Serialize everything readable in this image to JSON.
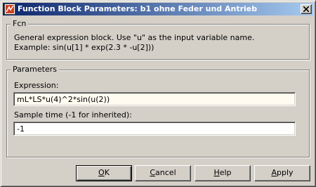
{
  "window": {
    "title": "Function Block Parameters: b1 ohne Feder und Antrieb"
  },
  "fcn_group": {
    "label": "Fcn",
    "description_line1": "General expression block. Use \"u\" as the input variable name.",
    "description_line2": "Example: sin(u[1] * exp(2.3 * -u[2]))"
  },
  "parameters_group": {
    "label": "Parameters",
    "expression_label": "Expression:",
    "expression_value": "mL*LS*u(4)^2*sin(u(2))",
    "sample_time_label": "Sample time (-1 for inherited):",
    "sample_time_value": "-1"
  },
  "buttons": {
    "ok": {
      "mnemonic": "O",
      "rest": "K"
    },
    "cancel": {
      "mnemonic": "C",
      "rest": "ancel"
    },
    "help": {
      "mnemonic": "H",
      "rest": "elp"
    },
    "apply": {
      "mnemonic": "A",
      "rest": "pply"
    }
  },
  "icons": {
    "app": "simulink-block-icon",
    "close": "close-icon"
  },
  "colors": {
    "title_bar_start": "#0a246a",
    "title_bar_end": "#a6caf0",
    "dialog_face": "#d4d0c8",
    "expression_field_bg": "#fffbf0"
  }
}
